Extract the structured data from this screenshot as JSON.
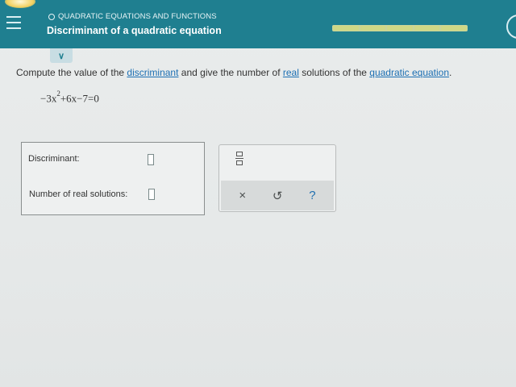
{
  "header": {
    "topic": "QUADRATIC EQUATIONS AND FUNCTIONS",
    "title": "Discriminant of a quadratic equation",
    "progress_segments": 5,
    "colors": {
      "header_bg": "#1f7f90",
      "progress": "#cfd886"
    }
  },
  "prompt": {
    "before": "Compute the value of the ",
    "link1": "discriminant",
    "middle": " and give the number of ",
    "link2": "real",
    "middle2": " solutions of the ",
    "link3": "quadratic equation",
    "end": "."
  },
  "equation": {
    "lhs_coef": "−3x",
    "exponent": "2",
    "rest": "+6x−7=0"
  },
  "answers": {
    "discriminant_label": "Discriminant:",
    "solutions_label": "Number of real solutions:"
  },
  "tools": {
    "fraction_icon": "fraction-icon",
    "clear_label": "×",
    "undo_label": "↺",
    "help_label": "?"
  }
}
